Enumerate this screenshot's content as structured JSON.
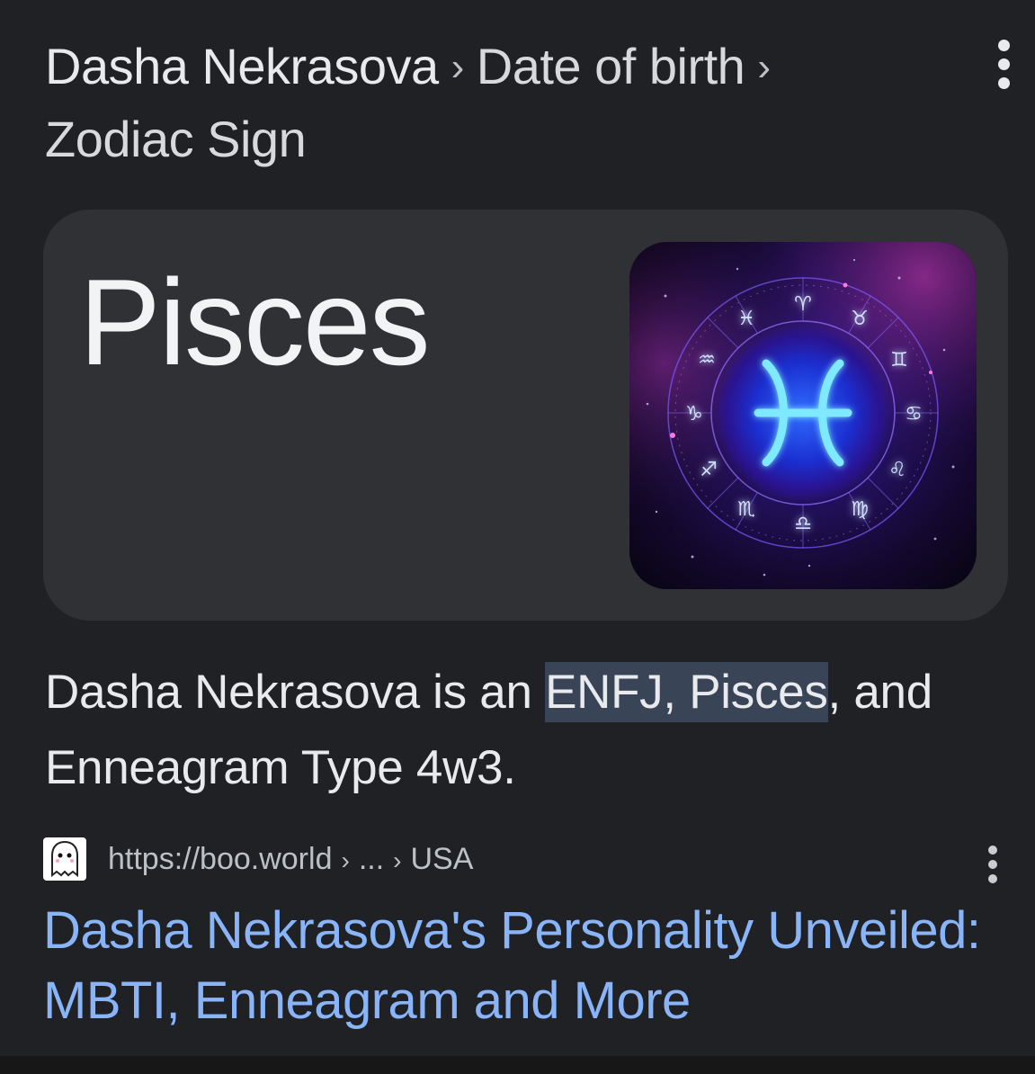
{
  "breadcrumb": {
    "items": [
      "Dasha Nekrasova",
      "Date of birth",
      "Zodiac Sign"
    ],
    "separator": "›"
  },
  "card": {
    "title": "Pisces",
    "image": {
      "icon": "pisces-zodiac-wheel-icon",
      "center_glyph": "♓",
      "wheel_glyphs": [
        "♓",
        "♈",
        "♉",
        "♊",
        "♋",
        "♌",
        "♍",
        "♎",
        "♏",
        "♐",
        "♑",
        "♒"
      ]
    }
  },
  "description": {
    "before": "Dasha Nekrasova is an ",
    "highlight": "ENFJ, Pisces",
    "after": ", and Enneagram Type 4w3."
  },
  "source": {
    "favicon": "ghost-icon",
    "url": "https://boo.world",
    "sep1": "›",
    "path1": "...",
    "sep2": "›",
    "path2": "USA"
  },
  "result": {
    "title": "Dasha Nekrasova's Personality Unveiled: MBTI, Enneagram and More"
  },
  "colors": {
    "background": "#202124",
    "card": "#303134",
    "link": "#8ab4f8",
    "highlight": "#394457",
    "text": "#e8eaed"
  }
}
